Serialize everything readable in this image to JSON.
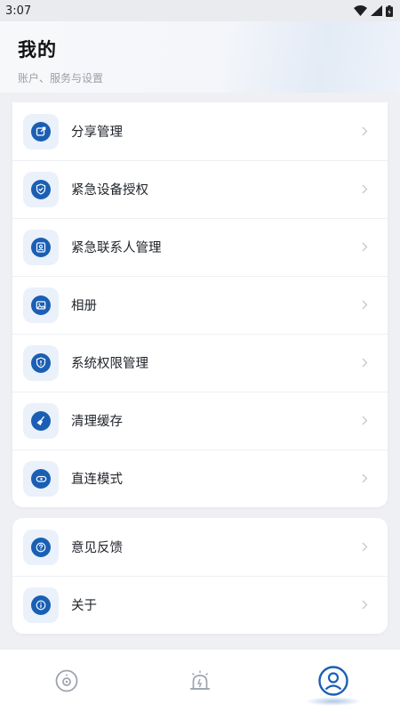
{
  "status_bar": {
    "time": "3:07"
  },
  "header": {
    "title": "我的",
    "subtitle": "账户、服务与设置"
  },
  "colors": {
    "accent": "#1a5fb4",
    "icon_tile_bg": "#eaf1fa",
    "chevron": "#c4c8ce"
  },
  "menu_group_1": [
    {
      "label": "分享管理",
      "icon": "share-edit-icon"
    },
    {
      "label": "紧急设备授权",
      "icon": "shield-check-icon"
    },
    {
      "label": "紧急联系人管理",
      "icon": "contact-card-icon"
    },
    {
      "label": "相册",
      "icon": "photo-album-icon"
    },
    {
      "label": "系统权限管理",
      "icon": "shield-alert-icon"
    },
    {
      "label": "清理缓存",
      "icon": "broom-icon"
    },
    {
      "label": "直连模式",
      "icon": "router-icon"
    }
  ],
  "menu_group_2": [
    {
      "label": "意见反馈",
      "icon": "question-icon"
    },
    {
      "label": "关于",
      "icon": "info-icon"
    }
  ],
  "tabbar": {
    "tabs": [
      {
        "icon": "camera-tab-icon",
        "active": false
      },
      {
        "icon": "alarm-tab-icon",
        "active": false
      },
      {
        "icon": "profile-tab-icon",
        "active": true
      }
    ]
  }
}
